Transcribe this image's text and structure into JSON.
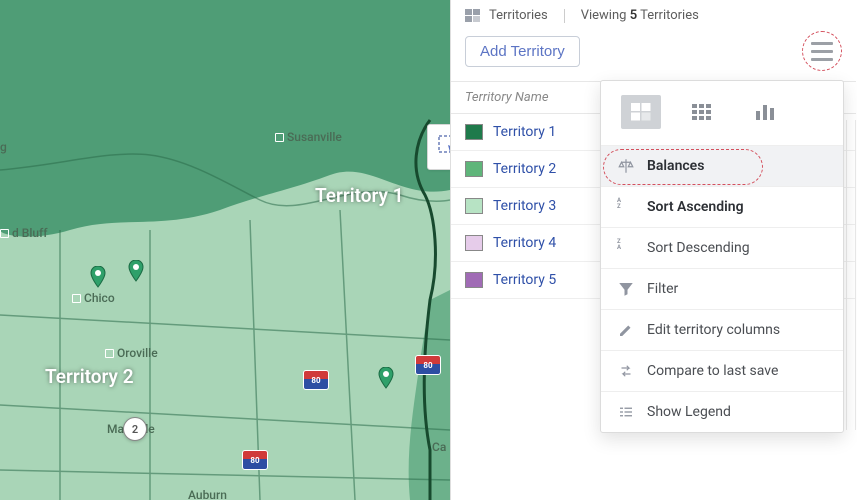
{
  "header": {
    "territories_tab": "Territories",
    "viewing_prefix": "Viewing",
    "territory_count": "5",
    "viewing_suffix": "Territories",
    "add_territory_label": "Add Territory"
  },
  "table": {
    "column_name_header": "Territory Name",
    "rows": [
      {
        "name": "Territory 1",
        "color": "#1f7a4b"
      },
      {
        "name": "Territory 2",
        "color": "#5fb57a"
      },
      {
        "name": "Territory 3",
        "color": "#b7e3c4"
      },
      {
        "name": "Territory 4",
        "color": "#e6ccea"
      },
      {
        "name": "Territory 5",
        "color": "#a06bb5"
      }
    ]
  },
  "menu": {
    "balances": "Balances",
    "sort_asc": "Sort Ascending",
    "sort_desc": "Sort Descending",
    "filter": "Filter",
    "edit_cols": "Edit territory columns",
    "compare": "Compare to last save",
    "legend": "Show Legend"
  },
  "map": {
    "territory_label_1": "Territory 1",
    "territory_label_2": "Territory 2",
    "cities": {
      "susanville": "Susanville",
      "red_bluff": "d Bluff",
      "chico": "Chico",
      "oroville": "Oroville",
      "marysville": "Ma   sville",
      "auburn": "Auburn",
      "ca": "Ca",
      "g": "g"
    },
    "cluster_count": "2",
    "hwy80": "80"
  },
  "colors": {
    "terr1_fill": "#4f9d76",
    "terr2_fill": "#9ccfae",
    "accent_link": "#2f50a8"
  }
}
